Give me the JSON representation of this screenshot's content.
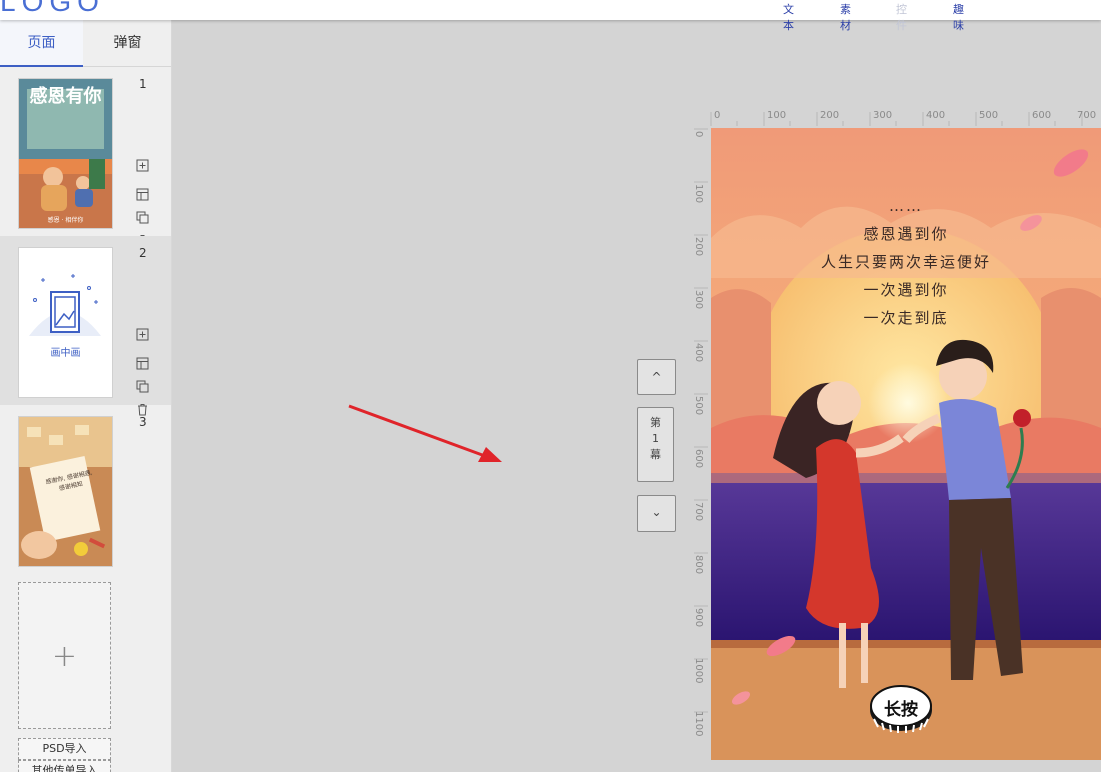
{
  "header": {
    "logo": "LOGO",
    "nav": [
      {
        "label": "文本",
        "disabled": false
      },
      {
        "label": "素材",
        "disabled": false
      },
      {
        "label": "控件",
        "disabled": true
      },
      {
        "label": "趣味",
        "disabled": false
      }
    ]
  },
  "sidebar": {
    "tabs": [
      "页面",
      "弹窗"
    ],
    "active_tab": "页面",
    "pages": [
      {
        "number": "1",
        "thumb": "thanksgiving-illustration",
        "thumb_caption": "感恩有你",
        "thumb_footer": "感恩 · 相伴你"
      },
      {
        "number": "2",
        "thumb": "picture-in-picture-icon",
        "thumb_caption": "画中画"
      },
      {
        "number": "3",
        "thumb": "handwritten-note-illustration",
        "thumb_caption": "感谢你, 感谢相遇, 感谢相知"
      }
    ],
    "add_page_symbol": "+",
    "buttons": [
      "PSD导入",
      "其他传单导入"
    ]
  },
  "scene_nav": {
    "up": "^",
    "label_lines": [
      "第",
      "1",
      "幕"
    ],
    "down": "⌄"
  },
  "rulers": {
    "top": [
      "0",
      "100",
      "200",
      "300",
      "400",
      "500",
      "600",
      "700"
    ],
    "left": [
      "0",
      "100",
      "200",
      "300",
      "400",
      "500",
      "600",
      "700",
      "800",
      "900",
      "1000",
      "1100"
    ]
  },
  "poster": {
    "poem": [
      "……",
      "感恩遇到你",
      "人生只要两次幸运便好",
      "一次遇到你",
      "一次走到底"
    ],
    "press_button": "长按"
  },
  "colors": {
    "accent": "#3d5fc4",
    "arrow": "#e0242a",
    "sky_top": "#f2a07a",
    "sea": "#3a1f8a"
  }
}
